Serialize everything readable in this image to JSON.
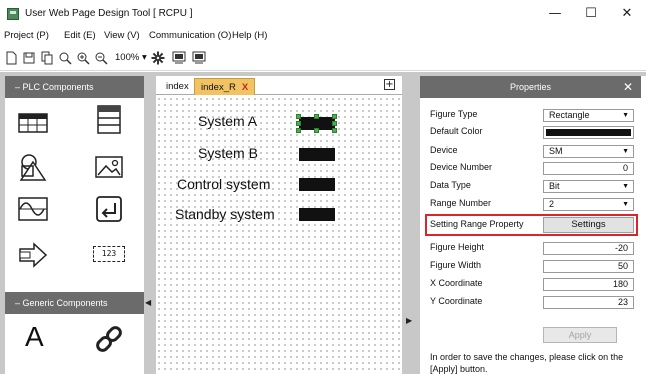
{
  "window": {
    "title": "User Web Page Design Tool [ RCPU ]",
    "minimize": "—",
    "maximize": "☐",
    "close": "✕"
  },
  "menu": [
    {
      "label": "Project (P)"
    },
    {
      "label": "Edit (E)"
    },
    {
      "label": "View (V)"
    },
    {
      "label": "Communication (O)"
    },
    {
      "label": "Help (H)"
    }
  ],
  "toolbar": {
    "zoom_value": "100%",
    "zoom_arrow": "▾",
    "icons": [
      "new-file-icon",
      "save-icon",
      "copy-icon",
      "zoom-fit-icon",
      "zoom-in-icon",
      "zoom-out-icon",
      "settings-icon",
      "upload-icon",
      "download-icon"
    ]
  },
  "left_panel": {
    "plc_header": "–   PLC Components",
    "generic_header": "–   Generic Components",
    "generic_text_glyph": "A",
    "numeric_label": "123"
  },
  "tabs": {
    "items": [
      {
        "label": "index"
      },
      {
        "label": "index_R",
        "close": "X"
      }
    ],
    "add": "+"
  },
  "canvas": {
    "items": [
      {
        "label": "System A"
      },
      {
        "label": "System B"
      },
      {
        "label": "Control system"
      },
      {
        "label": "Standby system"
      }
    ]
  },
  "properties": {
    "title": "Properties",
    "close": "✕",
    "rows": [
      {
        "label": "Figure Type",
        "value": "Rectangle",
        "type": "select"
      },
      {
        "label": "Default Color",
        "value": "",
        "type": "color"
      },
      {
        "label": "Device",
        "value": "SM",
        "type": "select"
      },
      {
        "label": "Device Number",
        "value": "0",
        "type": "number"
      },
      {
        "label": "Data Type",
        "value": "Bit",
        "type": "select"
      },
      {
        "label": "Range Number",
        "value": "2",
        "type": "select"
      },
      {
        "label": "Setting Range Property",
        "value": "Settings",
        "type": "button"
      },
      {
        "label": "Figure Height",
        "value": "-20",
        "type": "number"
      },
      {
        "label": "Figure Width",
        "value": "50",
        "type": "number"
      },
      {
        "label": "X Coordinate",
        "value": "180",
        "type": "number"
      },
      {
        "label": "Y Coordinate",
        "value": "23",
        "type": "number"
      }
    ],
    "apply_label": "Apply",
    "note": "In order to save the changes, please click on the [Apply] button."
  },
  "colors": {
    "panel_header": "#6b6b6b",
    "active_tab": "#f1c363",
    "highlight": "#d9262c",
    "selection_handle": "#4caf50"
  }
}
